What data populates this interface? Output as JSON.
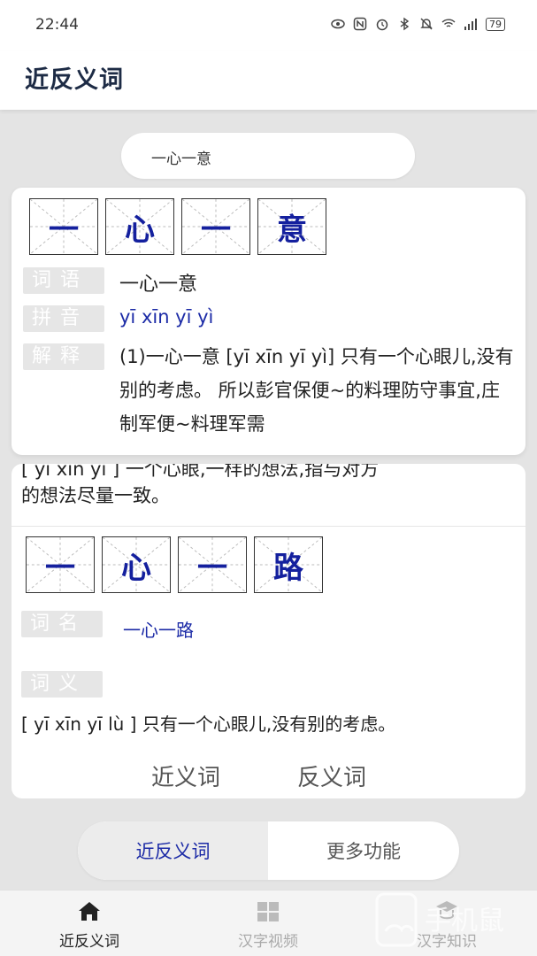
{
  "status_bar": {
    "time": "22:44",
    "battery": "79"
  },
  "app_bar": {
    "title": "近反义词"
  },
  "search": {
    "value": "一心一意"
  },
  "result_card": {
    "characters": [
      "一",
      "心",
      "一",
      "意"
    ],
    "word_label": "词语",
    "word": "一心一意",
    "pinyin_label": "拼音",
    "pinyin": "yī xīn yī yì",
    "explain_label": "解释",
    "explanation": "(1)一心一意 [yī xīn yī yì] 只有一个心眼儿,没有别的考虑。 所以彭官保便~的料理防守事宜,庄制军便~料理军需"
  },
  "similar_card": {
    "partial_line": "[ yī xīn yī ] 一个心眼,一样的想法,指与对方",
    "tail_line": "的想法尽量一致。",
    "characters": [
      "一",
      "心",
      "一",
      "路"
    ],
    "name_label": "词名",
    "name": "一心一路",
    "meaning_label": "词义",
    "meaning": "[ yī xīn yī lù ] 只有一个心眼儿,没有别的考虑。",
    "synonym_link": "近义词",
    "antonym_link": "反义词"
  },
  "mode_toggle": {
    "left": "近反义词",
    "right": "更多功能"
  },
  "bottom_nav": {
    "items": [
      {
        "label": "近反义词",
        "icon": "home-icon"
      },
      {
        "label": "汉字视频",
        "icon": "grid-icon"
      },
      {
        "label": "汉字知识",
        "icon": "knowledge-icon"
      }
    ]
  },
  "watermark": {
    "text": "手机鼠"
  },
  "colors": {
    "accent": "#1b2aa6",
    "character_blue": "#14209e",
    "label_gray": "#e6e6e6",
    "background": "#e4e4e4"
  }
}
